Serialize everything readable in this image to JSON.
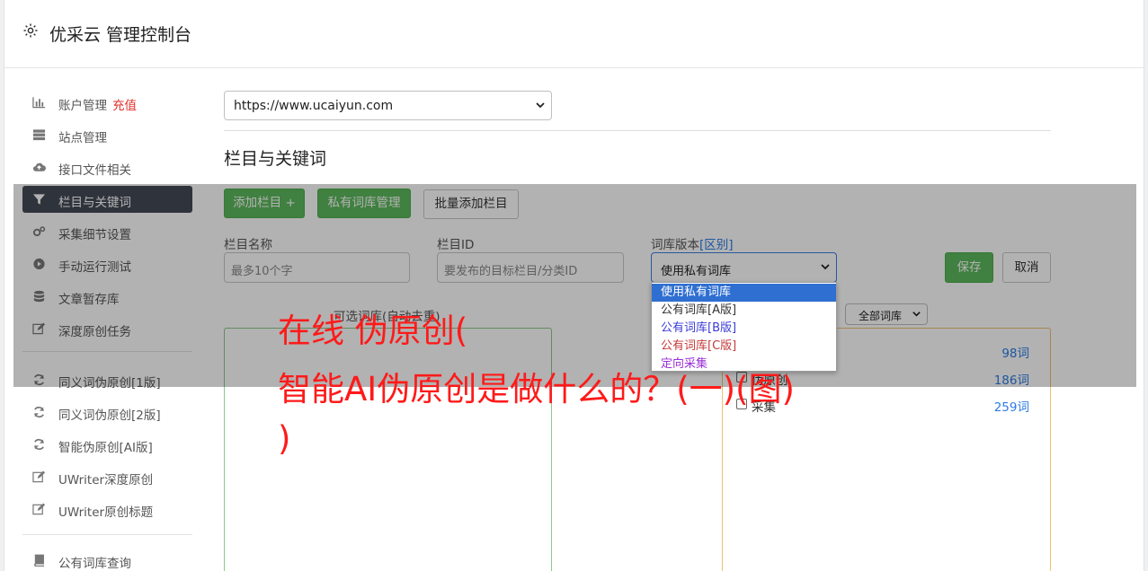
{
  "header": {
    "title": "优采云 管理控制台"
  },
  "sidebar": {
    "items": [
      {
        "label": "账户管理",
        "badge": "充值",
        "icon": "bar-chart-icon"
      },
      {
        "label": "站点管理",
        "icon": "server-icon"
      },
      {
        "label": "接口文件相关",
        "icon": "cloud-upload-icon"
      },
      {
        "label": "栏目与关键词",
        "icon": "filter-icon",
        "active": true
      },
      {
        "label": "采集细节设置",
        "icon": "cogs-icon"
      },
      {
        "label": "手动运行测试",
        "icon": "play-circle-icon"
      },
      {
        "label": "文章暂存库",
        "icon": "database-icon"
      },
      {
        "label": "深度原创任务",
        "icon": "edit-icon"
      },
      {
        "label": "同义词伪原创[1版]",
        "icon": "refresh-icon"
      },
      {
        "label": "同义词伪原创[2版]",
        "icon": "refresh-icon"
      },
      {
        "label": "智能伪原创[AI版]",
        "icon": "refresh-icon"
      },
      {
        "label": "UWriter深度原创",
        "icon": "edit-icon"
      },
      {
        "label": "UWriter原创标题",
        "icon": "edit-icon"
      },
      {
        "label": "公有词库查询",
        "icon": "book-icon"
      }
    ]
  },
  "site_select": {
    "value": "https://www.ucaiyun.com"
  },
  "section": {
    "title": "栏目与关键词"
  },
  "buttons": {
    "add_column": "添加栏目 +",
    "private_lib": "私有词库管理",
    "batch_add": "批量添加栏目",
    "save": "保存",
    "cancel": "取消"
  },
  "form": {
    "column_name": {
      "label": "栏目名称",
      "placeholder": "最多10个字"
    },
    "column_id": {
      "label": "栏目ID",
      "placeholder": "要发布的目标栏目/分类ID"
    },
    "lib_version": {
      "label": "词库版本",
      "label_link": "[区别]",
      "value": "使用私有词库"
    }
  },
  "dropdown": {
    "options": [
      {
        "label": "使用私有词库",
        "color": "#ffffff",
        "selected": true
      },
      {
        "label": "公有词库[A版]",
        "color": "#333333"
      },
      {
        "label": "公有词库[B版]",
        "color": "#3b3bd6"
      },
      {
        "label": "公有词库[C版]",
        "color": "#c43a3a"
      },
      {
        "label": "定向采集",
        "color": "#9a2fd6"
      }
    ]
  },
  "left_panel": {
    "title": "可选词库(自动去重)"
  },
  "right_panel": {
    "filter_value": "全部词库",
    "rows": [
      {
        "name": "",
        "count": "98词"
      },
      {
        "name": "伪原创",
        "count": "186词"
      },
      {
        "name": "采集",
        "count": "259词"
      }
    ]
  },
  "watermark": {
    "line1": "在线 伪原创(",
    "line2": "智能AI伪原创是做什么的？(一)(图)",
    "line3": ")"
  },
  "colors": {
    "primary_green": "#5cb85c",
    "active_nav": "#444b57",
    "link_blue": "#2c7be5",
    "watermark_red": "#ff1a1a"
  }
}
